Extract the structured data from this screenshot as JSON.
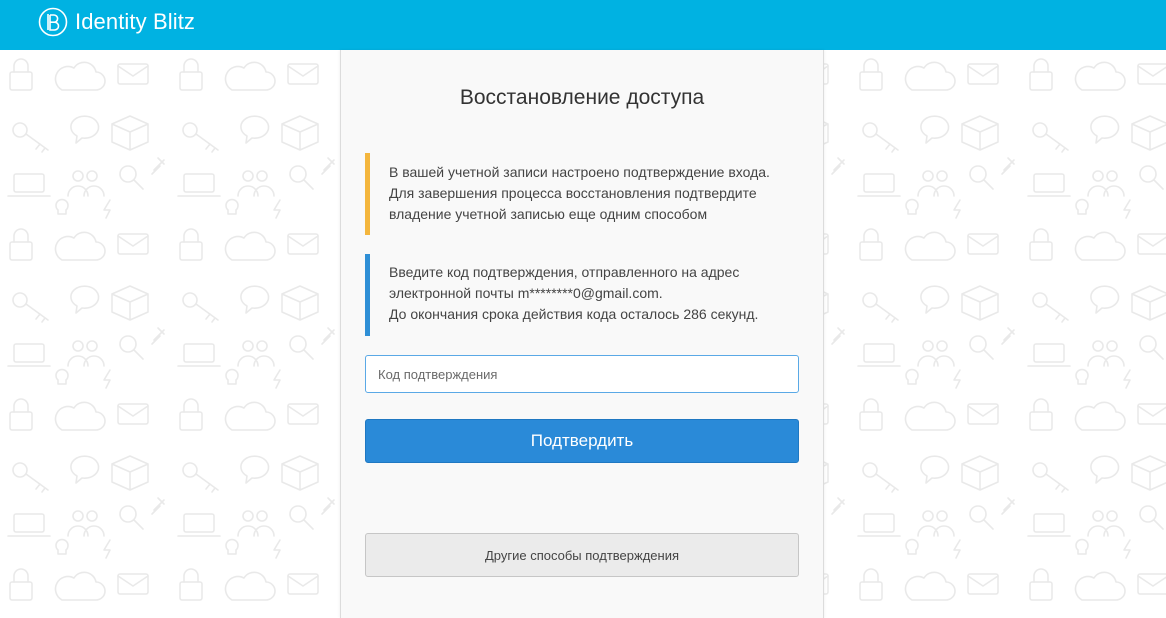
{
  "header": {
    "logo_text": "Identity Blitz",
    "background_color": "#00b2e2",
    "logo_icon": "blitz-logo-icon"
  },
  "card": {
    "title": "Восстановление доступа",
    "warning_notice": {
      "accent_color": "#f4b63d",
      "lines": [
        "В вашей учетной записи настроено подтверждение входа.",
        "Для завершения процесса восстановления подтвердите",
        "владение учетной записью еще одним способом"
      ]
    },
    "info_notice": {
      "accent_color": "#2f8fd6",
      "lines": [
        "Введите код подтверждения, отправленного на адрес",
        "электронной почты m********0@gmail.com.",
        "До окончания срока действия кода осталось 286 секунд."
      ]
    },
    "code_input": {
      "placeholder": "Код подтверждения",
      "value": ""
    },
    "confirm_button": {
      "label": "Подтвердить",
      "color": "#2a8ad8"
    },
    "other_methods_button": {
      "label": "Другие способы подтверждения"
    }
  },
  "background_pattern": {
    "icons": [
      "lock-icon",
      "key-icon",
      "cloud-icon",
      "envelope-icon",
      "sms-bubble-icon",
      "box-icon",
      "users-icon",
      "laptop-icon",
      "pin-icon",
      "lightning-icon",
      "bulb-icon",
      "magnifier-icon"
    ]
  }
}
